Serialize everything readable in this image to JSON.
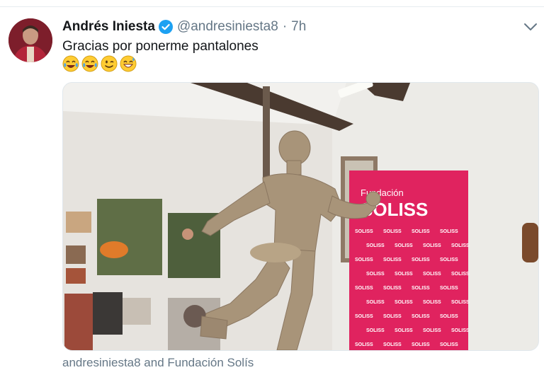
{
  "tweet": {
    "author_name": "Andrés Iniesta",
    "handle": "@andresiniesta8",
    "separator": "·",
    "time": "7h",
    "text": "Gracias por ponerme pantalones",
    "emojis": [
      "face-with-tears-of-joy",
      "face-with-tears-of-joy",
      "winking-face",
      "grinning-sweat-face"
    ],
    "verified": true
  },
  "media": {
    "banner_small": "Fundación",
    "banner_big": "SOLISS",
    "banner_repeat": "SOLISS"
  },
  "footer_text": "andresiniesta8 and Fundación Solís",
  "colors": {
    "verified_blue": "#1da1f2",
    "text_primary": "#14171a",
    "text_secondary": "#657786",
    "banner_pink": "#e0235f"
  }
}
